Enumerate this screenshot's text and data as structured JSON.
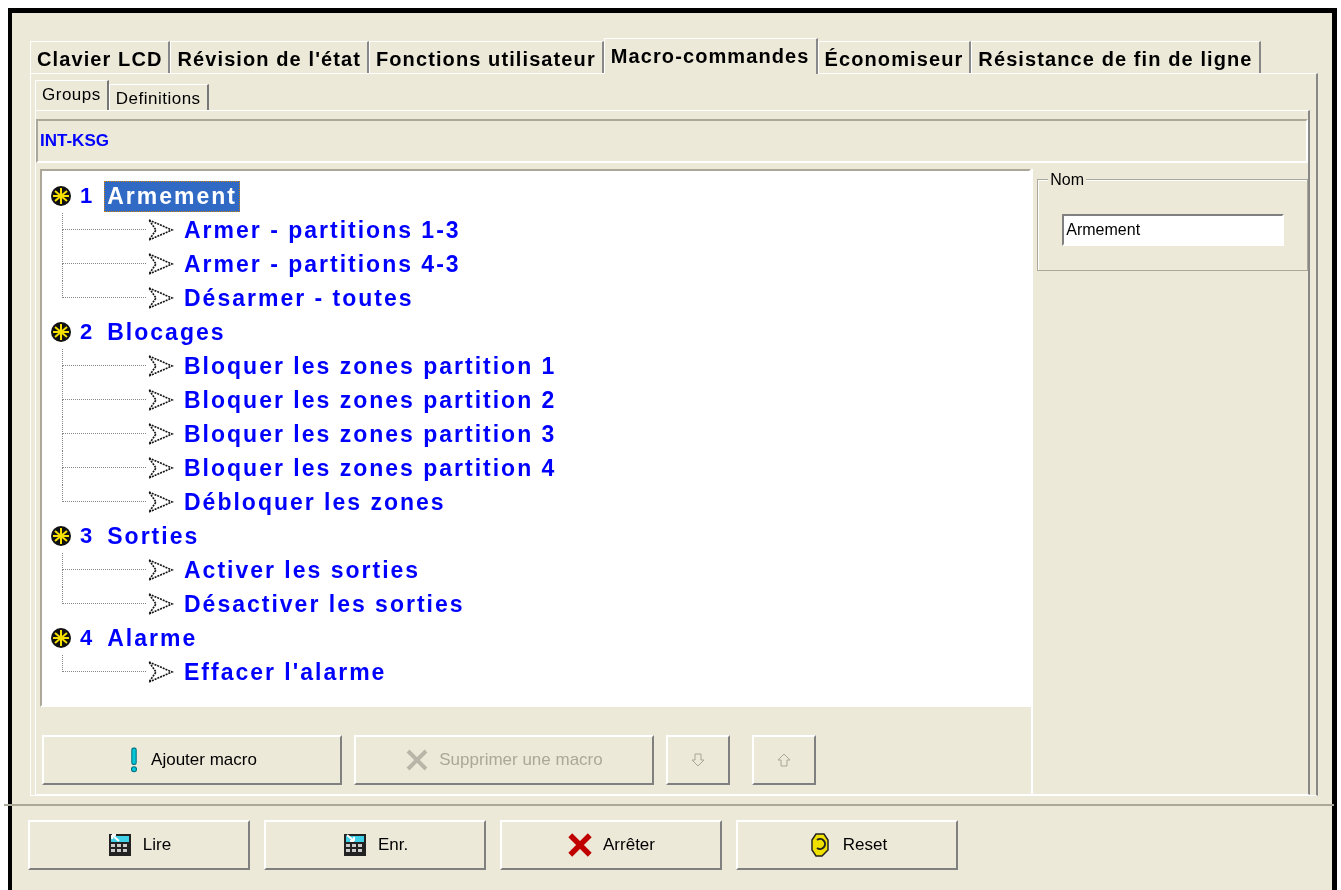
{
  "tabs": [
    {
      "label": "Clavier LCD",
      "selected": false
    },
    {
      "label": "Révision de l'état",
      "selected": false
    },
    {
      "label": "Fonctions utilisateur",
      "selected": false
    },
    {
      "label": "Macro-commandes",
      "selected": true
    },
    {
      "label": "Économiseur",
      "selected": false
    },
    {
      "label": "Résistance de fin de ligne",
      "selected": false
    }
  ],
  "subtabs": [
    {
      "label": "Groups",
      "selected": true
    },
    {
      "label": "Definitions",
      "selected": false
    }
  ],
  "device": "INT-KSG",
  "tree": [
    {
      "number": "1",
      "label": "Armement",
      "selected": true,
      "children": [
        {
          "label": "Armer - partitions 1-3"
        },
        {
          "label": "Armer - partitions 4-3"
        },
        {
          "label": "Désarmer - toutes"
        }
      ]
    },
    {
      "number": "2",
      "label": "Blocages",
      "selected": false,
      "children": [
        {
          "label": "Bloquer les zones partition 1"
        },
        {
          "label": "Bloquer les zones partition 2"
        },
        {
          "label": "Bloquer les zones partition 3"
        },
        {
          "label": "Bloquer les zones partition 4"
        },
        {
          "label": "Débloquer les zones"
        }
      ]
    },
    {
      "number": "3",
      "label": "Sorties",
      "selected": false,
      "children": [
        {
          "label": "Activer les sorties"
        },
        {
          "label": "Désactiver les sorties"
        }
      ]
    },
    {
      "number": "4",
      "label": "Alarme",
      "selected": false,
      "children": [
        {
          "label": "Effacer l'alarme"
        }
      ]
    }
  ],
  "name_field": {
    "label": "Nom",
    "value": "Armement"
  },
  "actions": [
    {
      "kind": "add",
      "label": "Ajouter macro",
      "disabled": false
    },
    {
      "kind": "delete",
      "label": "Supprimer une macro",
      "disabled": true
    },
    {
      "kind": "down",
      "disabled": true
    },
    {
      "kind": "up",
      "disabled": true
    }
  ],
  "bottom_buttons": [
    {
      "kind": "read",
      "label": "Lire"
    },
    {
      "kind": "write",
      "label": "Enr."
    },
    {
      "kind": "stop",
      "label": "Arrêter"
    },
    {
      "kind": "reset",
      "label": "Reset"
    }
  ]
}
